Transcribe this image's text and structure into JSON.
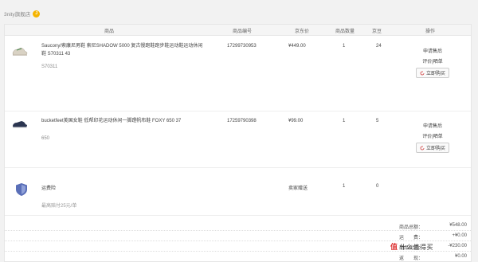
{
  "shop": {
    "name": "3nity旗舰店",
    "badge": "J"
  },
  "header": {
    "product": "商品",
    "id": "商品编号",
    "price": "京东价",
    "qty": "商品数量",
    "beans": "京豆",
    "ops": "操作"
  },
  "items": [
    {
      "name": "Saucony/索康尼男鞋 索尼SHADOW 5000 复古慢跑鞋跑步鞋运动鞋运动休闲鞋 S70311 43",
      "sku": "S70311",
      "id": "17299730953",
      "price": "¥449.00",
      "qty": "1",
      "beans": "24",
      "op_after_sale": "申请售后",
      "op_review": "评价|晒单",
      "op_buy": "立即购买"
    },
    {
      "name": "bucketfeet美国女鞋 低帮印花运动休闲一脚蹬帆布鞋 FOXY 650 37",
      "sku": "650",
      "id": "17259790398",
      "price": "¥99.00",
      "qty": "1",
      "beans": "5",
      "op_after_sale": "申请售后",
      "op_review": "评价|晒单",
      "op_buy": "立即购买"
    }
  ],
  "insurance": {
    "name": "运费险",
    "note": "最高赔付25元/单",
    "price": "卖家赠送",
    "qty": "1",
    "beans": "0"
  },
  "summary": [
    {
      "label": "商品总额：",
      "value": "¥548.00"
    },
    {
      "label": "运　　费：",
      "value": "+¥0.00"
    },
    {
      "label": "商品优惠：",
      "value": "-¥230.00"
    },
    {
      "label": "返　　现：",
      "value": "¥0.00"
    }
  ],
  "watermark": {
    "part1": "值",
    "part2": "什么值得买"
  },
  "colors": {
    "accent": "#e4393c",
    "header_bg": "#f5f5f5"
  }
}
